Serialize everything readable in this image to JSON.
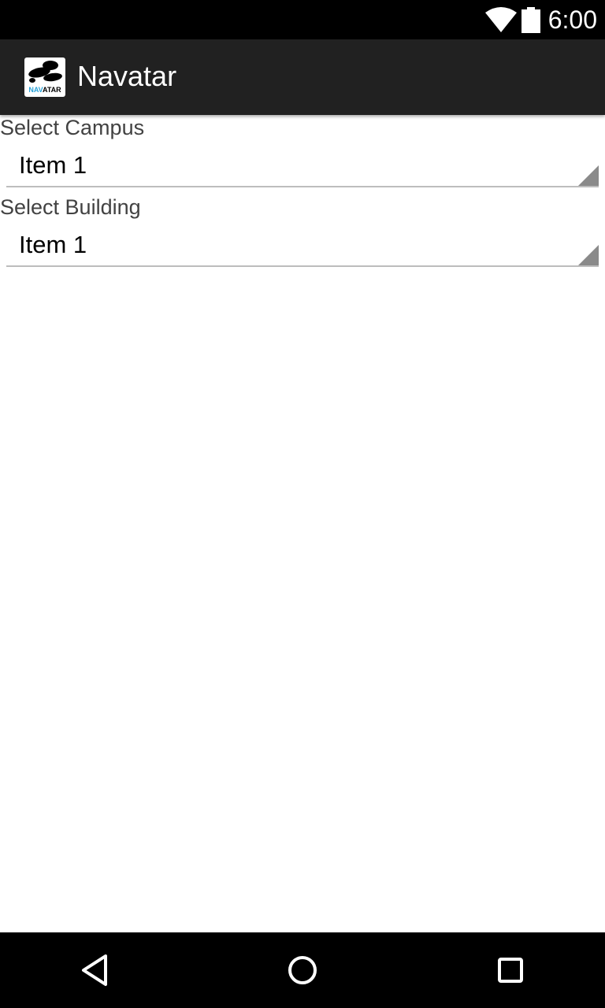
{
  "status_bar": {
    "time": "6:00",
    "icons": [
      "wifi-icon",
      "battery-icon"
    ]
  },
  "app_bar": {
    "title": "Navatar",
    "logo_text": "NAVATAR",
    "logo_icon": "navatar-logo-icon"
  },
  "form": {
    "campus": {
      "label": "Select Campus",
      "selected": "Item 1"
    },
    "building": {
      "label": "Select Building",
      "selected": "Item 1"
    }
  },
  "nav_bar": {
    "icons": [
      "back-icon",
      "home-icon",
      "recents-icon"
    ]
  },
  "colors": {
    "status_bar": "#000000",
    "app_bar": "#212121",
    "background": "#ffffff",
    "label_text": "#424242",
    "underline": "#bdbdbd",
    "logo_accent": "#29a3d9"
  }
}
